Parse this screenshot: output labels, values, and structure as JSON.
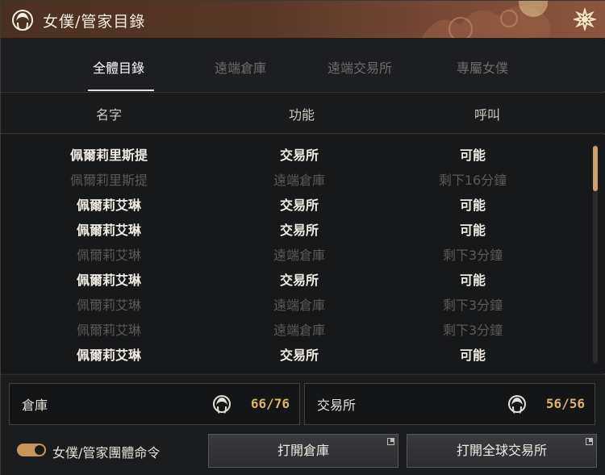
{
  "window": {
    "title": "女僕/管家目錄"
  },
  "tabs": [
    {
      "label": "全體目錄",
      "active": true
    },
    {
      "label": "遠端倉庫",
      "active": false
    },
    {
      "label": "遠端交易所",
      "active": false
    },
    {
      "label": "專屬女僕",
      "active": false
    }
  ],
  "columns": {
    "name": "名字",
    "function": "功能",
    "call": "呼叫"
  },
  "rows": [
    {
      "name": "佩爾莉里斯提",
      "function": "交易所",
      "call": "可能",
      "available": true
    },
    {
      "name": "佩爾莉里斯提",
      "function": "遠端倉庫",
      "call": "剩下16分鐘",
      "available": false
    },
    {
      "name": "佩爾莉艾琳",
      "function": "交易所",
      "call": "可能",
      "available": true
    },
    {
      "name": "佩爾莉艾琳",
      "function": "交易所",
      "call": "可能",
      "available": true
    },
    {
      "name": "佩爾莉艾琳",
      "function": "遠端倉庫",
      "call": "剩下3分鐘",
      "available": false
    },
    {
      "name": "佩爾莉艾琳",
      "function": "交易所",
      "call": "可能",
      "available": true
    },
    {
      "name": "佩爾莉艾琳",
      "function": "遠端倉庫",
      "call": "剩下3分鐘",
      "available": false
    },
    {
      "name": "佩爾莉艾琳",
      "function": "遠端倉庫",
      "call": "剩下3分鐘",
      "available": false
    },
    {
      "name": "佩爾莉艾琳",
      "function": "交易所",
      "call": "可能",
      "available": true
    }
  ],
  "summary": {
    "warehouse": {
      "label": "倉庫",
      "count": "66/76",
      "icon": "maid-icon"
    },
    "market": {
      "label": "交易所",
      "count": "56/56",
      "icon": "maid-icon"
    }
  },
  "footer": {
    "toggle_label": "女僕/管家團體命令",
    "toggle_on": true,
    "open_warehouse": "打開倉庫",
    "open_market": "打開全球交易所"
  },
  "colors": {
    "accent": "#c9a06a",
    "value": "#d9b56e",
    "titlebar": "#5a3828"
  }
}
